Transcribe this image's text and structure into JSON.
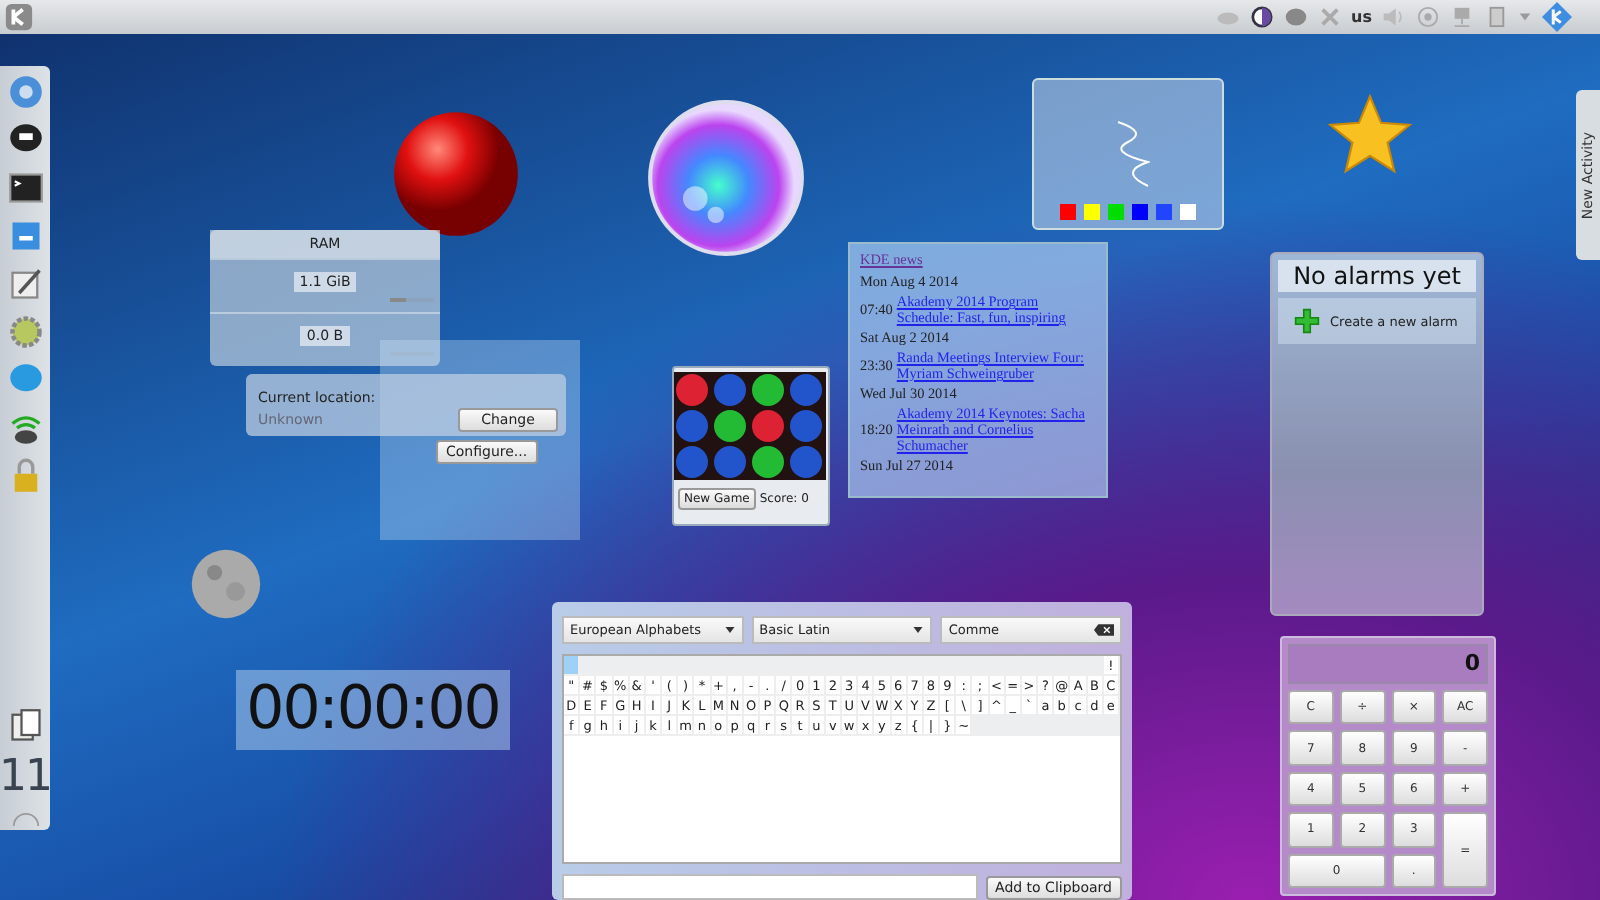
{
  "top_bar": {
    "keyboard_layout": "us"
  },
  "side_panel": {
    "clock": "11"
  },
  "new_activity_tab": {
    "label": "New Activity"
  },
  "scribble": {
    "palette": [
      {
        "color": "#ff0000"
      },
      {
        "color": "#ffff00"
      },
      {
        "color": "#00dd00"
      },
      {
        "color": "#0000ff"
      },
      {
        "color": "#2244ff"
      },
      {
        "color": "#ffffff"
      }
    ]
  },
  "ram_monitor": {
    "title": "RAM",
    "rows": [
      {
        "value": "1.1 GiB",
        "level": 0.35
      },
      {
        "value": "0.0 B"
      }
    ]
  },
  "location": {
    "label": "Current location:",
    "value": "Unknown",
    "button": "Change"
  },
  "configure_button": "Configure...",
  "game": {
    "new_game_button": "New Game",
    "score": "Score: 0"
  },
  "news": {
    "title": "KDE news",
    "days": [
      {
        "date": "Mon Aug 4 2014",
        "items": [
          {
            "time": "07:40",
            "title": "Akademy 2014 Program Schedule: Fast, fun, inspiring"
          }
        ]
      },
      {
        "date": "Sat Aug 2 2014",
        "items": [
          {
            "time": "23:30",
            "title": "Randa Meetings Interview Four: Myriam Schweingruber"
          }
        ]
      },
      {
        "date": "Wed Jul 30 2014",
        "items": [
          {
            "time": "18:20",
            "title": "Akademy 2014 Keynotes: Sacha Meinrath and Cornelius Schumacher"
          }
        ]
      },
      {
        "date": "Sun Jul 27 2014"
      }
    ]
  },
  "alarms": {
    "title": "No alarms yet",
    "action": "Create a new alarm"
  },
  "stopwatch": "00:00:00",
  "character_map": {
    "script": "European Alphabets",
    "block": "Basic Latin",
    "search": "Comme",
    "first_cell_selected": true,
    "characters": [
      "!",
      "\"",
      "#",
      "$",
      "%",
      "&",
      "'",
      "(",
      ")",
      "*",
      "+",
      ",",
      "-",
      ".",
      "/",
      "0",
      "1",
      "2",
      "3",
      "4",
      "5",
      "6",
      "7",
      "8",
      "9",
      ":",
      ";",
      "<",
      "=",
      ">",
      "?",
      "@",
      "A",
      "B",
      "C",
      "D",
      "E",
      "F",
      "G",
      "H",
      "I",
      "J",
      "K",
      "L",
      "M",
      "N",
      "O",
      "P",
      "Q",
      "R",
      "S",
      "T",
      "U",
      "V",
      "W",
      "X",
      "Y",
      "Z",
      "[",
      "\\",
      "]",
      "^",
      "_",
      "`",
      "a",
      "b",
      "c",
      "d",
      "e",
      "f",
      "g",
      "h",
      "i",
      "j",
      "k",
      "l",
      "m",
      "n",
      "o",
      "p",
      "q",
      "r",
      "s",
      "t",
      "u",
      "v",
      "w",
      "x",
      "y",
      "z",
      "{",
      "|",
      "}",
      "~"
    ],
    "add_button": "Add to Clipboard"
  },
  "calculator": {
    "display": "0",
    "keys": [
      {
        "label": "C",
        "kind": "normal"
      },
      {
        "label": "÷",
        "kind": "normal"
      },
      {
        "label": "×",
        "kind": "normal"
      },
      {
        "label": "AC",
        "kind": "normal"
      },
      {
        "label": "7",
        "kind": "normal"
      },
      {
        "label": "8",
        "kind": "normal"
      },
      {
        "label": "9",
        "kind": "normal"
      },
      {
        "label": "-",
        "kind": "normal"
      },
      {
        "label": "4",
        "kind": "normal"
      },
      {
        "label": "5",
        "kind": "normal"
      },
      {
        "label": "6",
        "kind": "normal"
      },
      {
        "label": "+",
        "kind": "normal"
      },
      {
        "label": "1",
        "kind": "normal"
      },
      {
        "label": "2",
        "kind": "normal"
      },
      {
        "label": "3",
        "kind": "normal"
      },
      {
        "label": "=",
        "kind": "tall"
      },
      {
        "label": "0",
        "kind": "wide"
      },
      {
        "label": ".",
        "kind": "normal"
      }
    ]
  }
}
